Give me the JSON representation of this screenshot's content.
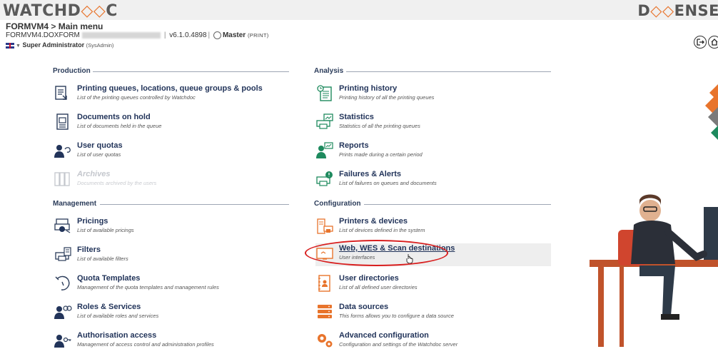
{
  "header": {
    "logo_left_a": "WATCHD",
    "logo_left_b": "◇◇",
    "logo_left_c": "C",
    "logo_right_a": "D",
    "logo_right_b": "◇◇",
    "logo_right_c": "ENSE"
  },
  "breadcrumb": {
    "server": "FORMVM4",
    "separator": ">",
    "page": "Main menu"
  },
  "info": {
    "host": "FORMVM4.DOXFORM",
    "version": "v6.1.0.4898",
    "role": "Master",
    "role_tag": "(PRINT)"
  },
  "user": {
    "name": "Super Administrator",
    "account": "(SysAdmin)"
  },
  "toolbar": {
    "logout_icon": "logout-icon",
    "home_icon": "home-icon"
  },
  "sections": {
    "production": "Production",
    "management": "Management",
    "analysis": "Analysis",
    "configuration": "Configuration"
  },
  "production_items": [
    {
      "title": "Printing queues, locations, queue groups & pools",
      "desc": "List of the printing queues controlled by Watchdoc",
      "icon": "printer-queue-icon"
    },
    {
      "title": "Documents on hold",
      "desc": "List of documents held in the queue",
      "icon": "document-hold-icon"
    },
    {
      "title": "User quotas",
      "desc": "List of user quotas",
      "icon": "user-quota-icon"
    },
    {
      "title": "Archives",
      "desc": "Documents archived by the users",
      "icon": "archive-icon"
    }
  ],
  "management_items": [
    {
      "title": "Pricings",
      "desc": "List of available pricings",
      "icon": "pricing-icon"
    },
    {
      "title": "Filters",
      "desc": "List of available filters",
      "icon": "filter-icon"
    },
    {
      "title": "Quota Templates",
      "desc": "Management of the quota templates and management rules",
      "icon": "quota-template-icon"
    },
    {
      "title": "Roles & Services",
      "desc": "List of available roles and services",
      "icon": "roles-icon"
    },
    {
      "title": "Authorisation access",
      "desc": "Management of access control and administration profiles",
      "icon": "authorisation-icon"
    }
  ],
  "analysis_items": [
    {
      "title": "Printing history",
      "desc": "Printing history of all the printing queues",
      "icon": "history-icon"
    },
    {
      "title": "Statistics",
      "desc": "Statistics of all the printing queues",
      "icon": "statistics-icon"
    },
    {
      "title": "Reports",
      "desc": "Prints made during a certain period",
      "icon": "reports-icon"
    },
    {
      "title": "Failures & Alerts",
      "desc": "List of failures on queues and documents",
      "icon": "alert-icon"
    }
  ],
  "configuration_items": [
    {
      "title": "Printers & devices",
      "desc": "List of devices defined in the system",
      "icon": "printers-icon"
    },
    {
      "title": "Web, WES & Scan destinations",
      "desc": "User interfaces",
      "icon": "web-wes-icon"
    },
    {
      "title": "User directories",
      "desc": "List of all defined user directories",
      "icon": "directory-icon"
    },
    {
      "title": "Data sources",
      "desc": "This forms allows you to configure a data source",
      "icon": "data-source-icon"
    },
    {
      "title": "Advanced configuration",
      "desc": "Configuration and settings of the Watchdoc server",
      "icon": "gears-icon"
    }
  ],
  "colors": {
    "accent": "#e8742c",
    "title": "#22345a",
    "highlight_ring": "#d81e1e",
    "icon_green": "#1e8a5e"
  }
}
